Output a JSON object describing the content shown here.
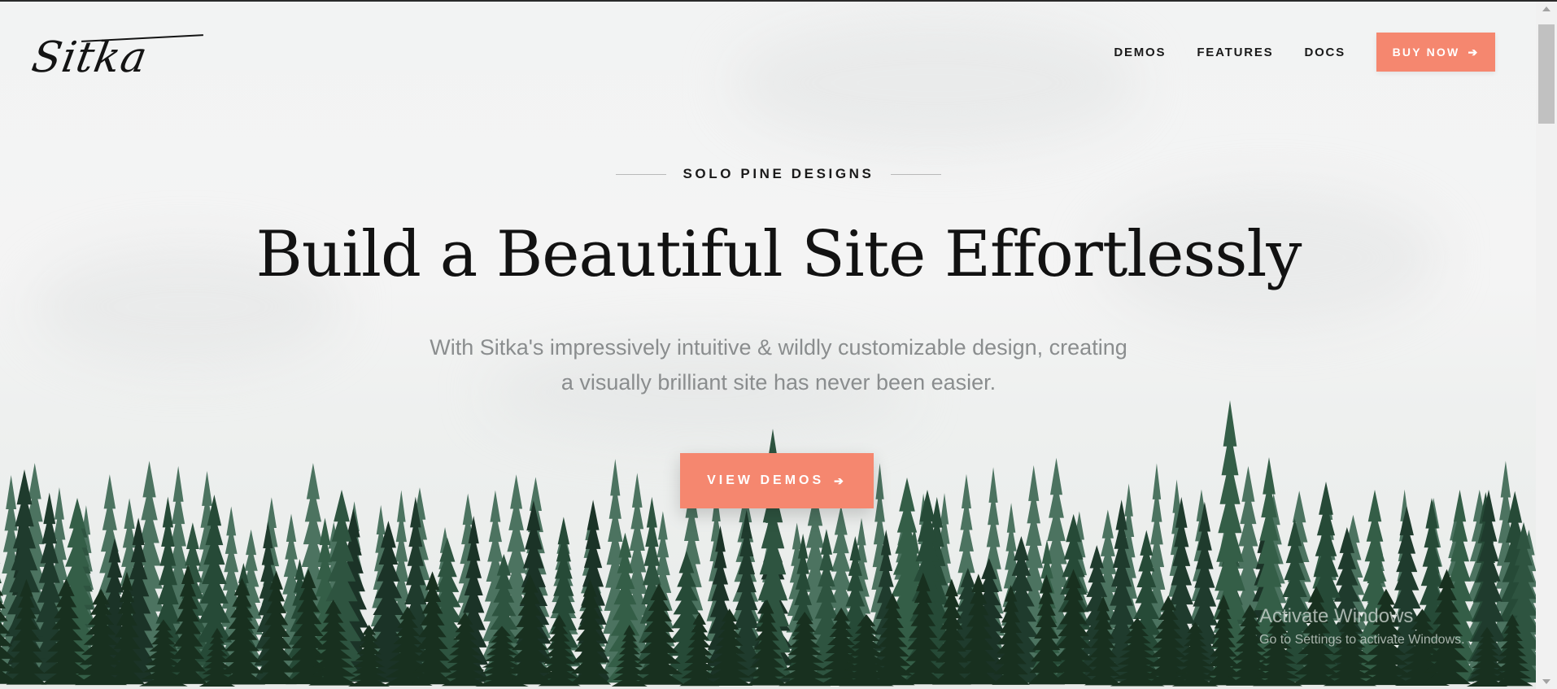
{
  "brand": {
    "logo_text": "Sitka"
  },
  "nav": {
    "items": [
      {
        "label": "DEMOS"
      },
      {
        "label": "FEATURES"
      },
      {
        "label": "DOCS"
      }
    ],
    "cta_label": "BUY NOW",
    "cta_icon": "arrow-right-icon"
  },
  "hero": {
    "eyebrow": "SOLO PINE DESIGNS",
    "headline": "Build a Beautiful Site Effortlessly",
    "subtitle_line1": "With Sitka's impressively intuitive & wildly customizable design, creating",
    "subtitle_line2": "a visually brilliant site has never been easier.",
    "cta_label": "VIEW DEMOS",
    "cta_icon": "arrow-right-icon"
  },
  "watermark": {
    "title": "Activate Windows",
    "subtitle": "Go to Settings to activate Windows."
  },
  "colors": {
    "accent": "#f5876f",
    "text_dark": "#1a1a1a",
    "text_muted": "#8a8d8e",
    "forest_dark": "#1f3b2d",
    "forest_mid": "#2e5440"
  }
}
